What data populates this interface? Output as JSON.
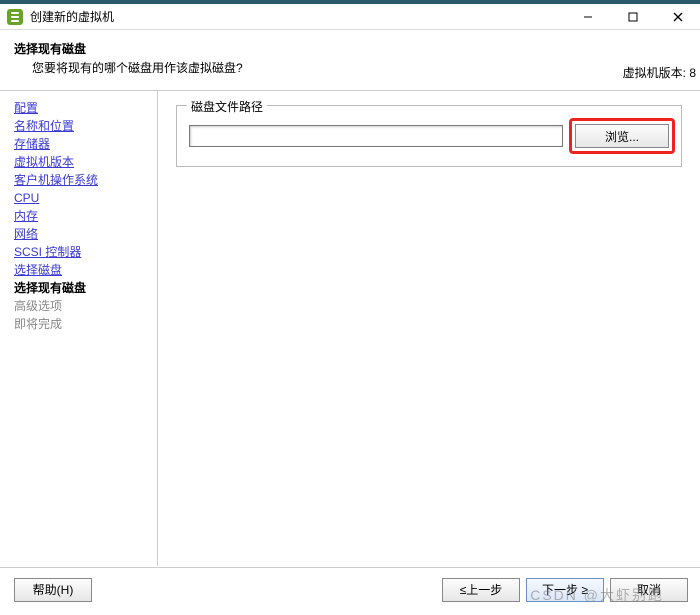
{
  "titlebar": {
    "title": "创建新的虚拟机"
  },
  "header": {
    "title": "选择现有磁盘",
    "subtitle": "您要将现有的哪个磁盘用作该虚拟磁盘?",
    "version_label": "虚拟机版本: 8"
  },
  "sidebar": {
    "items": [
      {
        "label": "配置",
        "state": "link"
      },
      {
        "label": "名称和位置",
        "state": "link"
      },
      {
        "label": "存储器",
        "state": "link"
      },
      {
        "label": "虚拟机版本",
        "state": "link"
      },
      {
        "label": "客户机操作系统",
        "state": "link"
      },
      {
        "label": "CPU",
        "state": "link"
      },
      {
        "label": "内存",
        "state": "link"
      },
      {
        "label": "网络",
        "state": "link"
      },
      {
        "label": "SCSI 控制器",
        "state": "link"
      },
      {
        "label": "选择磁盘",
        "state": "link"
      },
      {
        "label": "选择现有磁盘",
        "state": "current"
      },
      {
        "label": "高级选项",
        "state": "disabled"
      },
      {
        "label": "即将完成",
        "state": "disabled"
      }
    ]
  },
  "content": {
    "fieldset_legend": "磁盘文件路径",
    "path_value": "",
    "browse_label": "浏览..."
  },
  "footer": {
    "help": "帮助(H)",
    "back": "≤上一步",
    "next": "下一步 ≥",
    "cancel": "取消"
  },
  "watermark": "CSDN @大虾别跑"
}
